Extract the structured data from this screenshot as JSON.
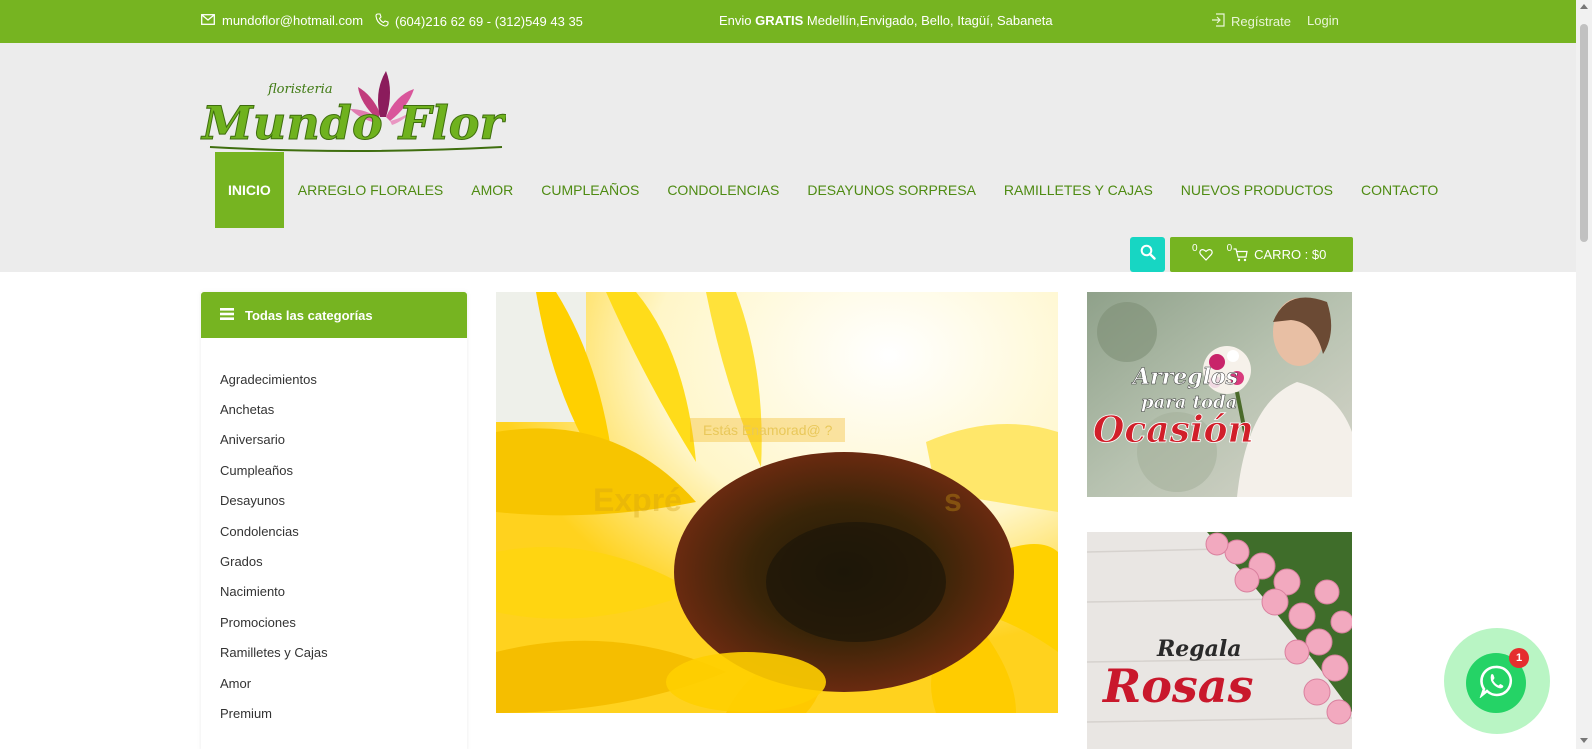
{
  "topbar": {
    "email": "mundoflor@hotmail.com",
    "phone": "(604)216 62 69 - (312)549 43 35",
    "shipping_prefix": "Envio ",
    "shipping_bold": "GRATIS",
    "shipping_rest": " Medellín,Envigado, Bello, Itagüí, Sabaneta",
    "register": "Regístrate",
    "login": "Login"
  },
  "logo": {
    "small": "floristeria",
    "main": "Mundo Flor"
  },
  "nav": {
    "items": [
      {
        "label": "INICIO"
      },
      {
        "label": "ARREGLO FLORALES"
      },
      {
        "label": "AMOR"
      },
      {
        "label": "CUMPLEAÑOS"
      },
      {
        "label": "CONDOLENCIAS"
      },
      {
        "label": "DESAYUNOS SORPRESA"
      },
      {
        "label": "RAMILLETES Y CAJAS"
      },
      {
        "label": "NUEVOS PRODUCTOS"
      },
      {
        "label": "CONTACTO"
      }
    ]
  },
  "cart": {
    "wishlist_count": "0",
    "cart_count": "0",
    "label": "CARRO : $0"
  },
  "sidebar": {
    "title": "Todas las categorías",
    "items": [
      {
        "label": "Agradecimientos"
      },
      {
        "label": "Anchetas"
      },
      {
        "label": "Aniversario"
      },
      {
        "label": "Cumpleaños"
      },
      {
        "label": "Desayunos"
      },
      {
        "label": "Condolencias"
      },
      {
        "label": "Grados"
      },
      {
        "label": "Nacimiento"
      },
      {
        "label": "Promociones"
      },
      {
        "label": "Ramilletes y Cajas"
      },
      {
        "label": "Amor"
      },
      {
        "label": "Premium"
      }
    ]
  },
  "hero": {
    "tagline": "Estás Enamorad@ ?",
    "title_left": "Expré",
    "title_right": "s"
  },
  "banners": {
    "first": {
      "line1": "Arreglos",
      "line2": "para toda",
      "line3": "Ocasión"
    },
    "second": {
      "line1": "Regala",
      "line2": "Rosas"
    }
  },
  "whatsapp": {
    "badge": "1"
  },
  "colors": {
    "brand_green": "#76b421",
    "search_teal": "#17d6c3",
    "whatsapp": "#25d366"
  }
}
